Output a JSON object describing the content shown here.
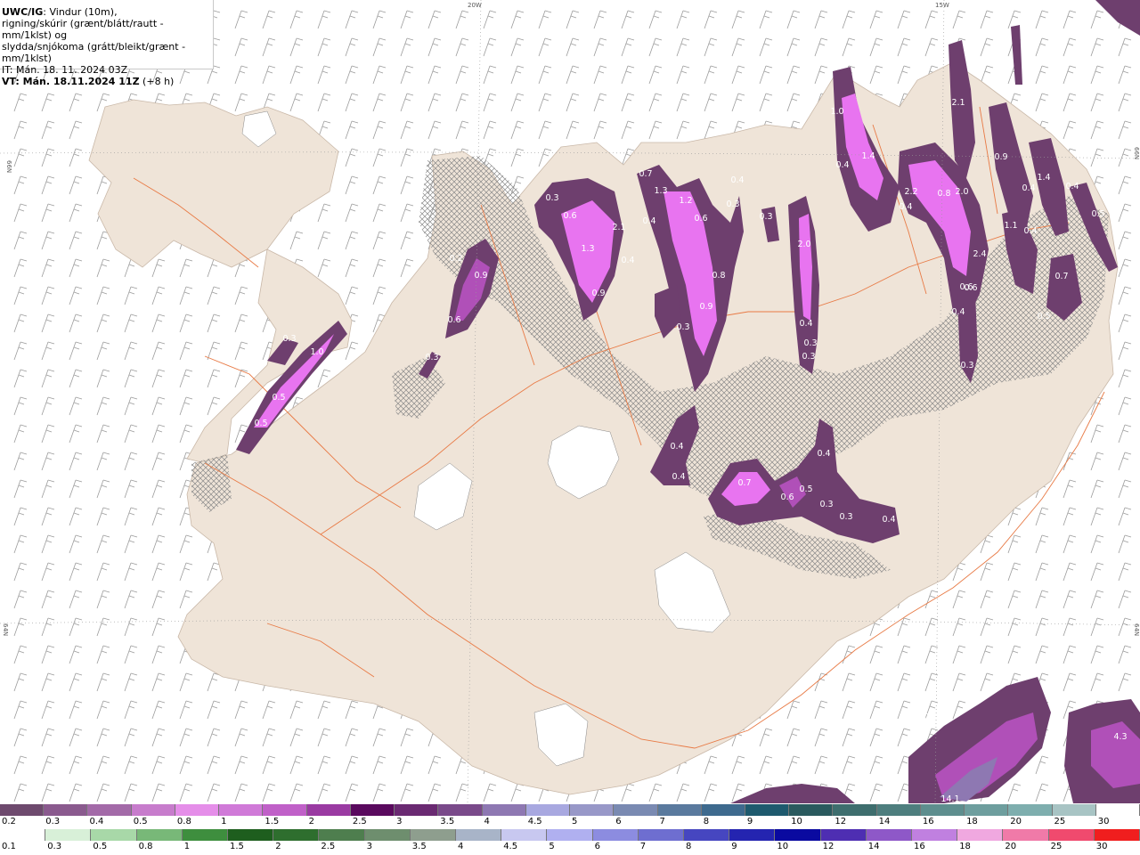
{
  "header": {
    "model": "UWC/IG",
    "line1": ": Vindur (10m),",
    "line2": "rigning/skúrir (grænt/blátt/rautt - mm/1klst) og",
    "line3": "slydda/snjókoma (grátt/bleikt/grænt - mm/1klst)",
    "issue": "IT: Mán. 18. 11. 2024 03Z",
    "valid_prefix": "VT: Mán. 18.11.2024 11Z",
    "valid_suffix": " (+8 h)"
  },
  "graticule": {
    "top_20w": "20W",
    "top_15w": "15W",
    "left_66n": "66N",
    "left_64n": "64N",
    "right_66n": "66N",
    "right_64n": "64N"
  },
  "colors": {
    "land": "#efe4d8",
    "sea": "#ffffff",
    "roads": "#e87a45",
    "precip_dark": "#6e3f6e",
    "precip_mid": "#b050b8",
    "precip_light": "#e874f0",
    "hatch": "#8a8a8a"
  },
  "precip_labels": [
    "0.3",
    "0.6",
    "2.1",
    "0.7",
    "1.3",
    "0.9",
    "0.4",
    "1.3",
    "1.2",
    "0.6",
    "0.4",
    "0.3",
    "0.4",
    "0.9",
    "0.8",
    "0.3",
    "0.3",
    "2.0",
    "0.4",
    "0.3",
    "0.3",
    "1.0",
    "0.4",
    "1.4",
    "2.2",
    "0.8",
    "2.0",
    "2.1",
    "0.9",
    "0.4",
    "1.4",
    "0.4",
    "0.5",
    "0.6",
    "1.1",
    "0.4",
    "2.4",
    "0.6",
    "0.4",
    "0.7",
    "0.5",
    "0.3",
    "0.2",
    "0.9",
    "0.6",
    "0.3",
    "0.3",
    "1.0",
    "0.5",
    "0.5",
    "0.4",
    "0.4",
    "0.7",
    "0.6",
    "0.5",
    "0.4",
    "0.4",
    "0.3",
    "0.3",
    "0.4",
    "0.3",
    "14.1",
    "4.3"
  ],
  "legend": {
    "snow_labels": [
      "0.2",
      "0.3",
      "0.4",
      "0.5",
      "0.8",
      "1",
      "1.5",
      "2",
      "2.5",
      "3",
      "3.5",
      "4",
      "4.5",
      "5",
      "6",
      "7",
      "8",
      "9",
      "10",
      "12",
      "14",
      "16",
      "18",
      "20",
      "25",
      "30"
    ],
    "snow_colors": [
      "#6e4a6e",
      "#8a5a8e",
      "#a36aa8",
      "#c77ccc",
      "#e58ee9",
      "#d07ad8",
      "#c060c8",
      "#9a3aa2",
      "#5a0a5e",
      "#6a2a72",
      "#7a4a8a",
      "#8e78b2",
      "#a8a8e0",
      "#9898c8",
      "#7a8ab2",
      "#5a7a9e",
      "#3e6a8e",
      "#1e5a6e",
      "#2a5a5e",
      "#3e6e6e",
      "#4e7e7e",
      "#5e8e8e",
      "#6e9e9e",
      "#7eaeae",
      "#a8c4c4",
      "#ffffff"
    ],
    "rain_labels": [
      "0.1",
      "0.3",
      "0.5",
      "0.8",
      "1",
      "1.5",
      "2",
      "2.5",
      "3",
      "3.5",
      "4",
      "4.5",
      "5",
      "6",
      "7",
      "8",
      "9",
      "10",
      "12",
      "14",
      "16",
      "18",
      "20",
      "25",
      "30"
    ],
    "rain_colors": [
      "#ffffff",
      "#d8f0d8",
      "#a8d8a8",
      "#78b878",
      "#3e8e3e",
      "#1e5e1e",
      "#2e6e2e",
      "#4e7e4e",
      "#6e8e6e",
      "#8e9e8e",
      "#a8b4c8",
      "#c8c8f0",
      "#b0b0f0",
      "#8c8ce0",
      "#6e6ed0",
      "#4646c0",
      "#2424b0",
      "#0a0aa0",
      "#4e2eb2",
      "#8e58c8",
      "#c080e0",
      "#f0a8e0",
      "#f07aa8",
      "#f04a6e",
      "#f01e1e"
    ]
  }
}
